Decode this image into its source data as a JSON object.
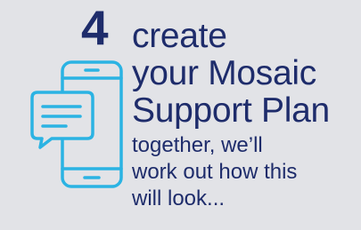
{
  "step": {
    "number": "4"
  },
  "title": {
    "line1": "create",
    "line2": "your Mosaic",
    "line3": "Support Plan"
  },
  "subtitle": {
    "line1": "together, we’ll",
    "line2": "work out how this",
    "line3": "will look..."
  },
  "icon": {
    "name": "phone-chat-icon",
    "color": "#2bb3e3"
  },
  "colors": {
    "background": "#e2e3e7",
    "text": "#1e2c6b",
    "accent": "#2bb3e3"
  }
}
